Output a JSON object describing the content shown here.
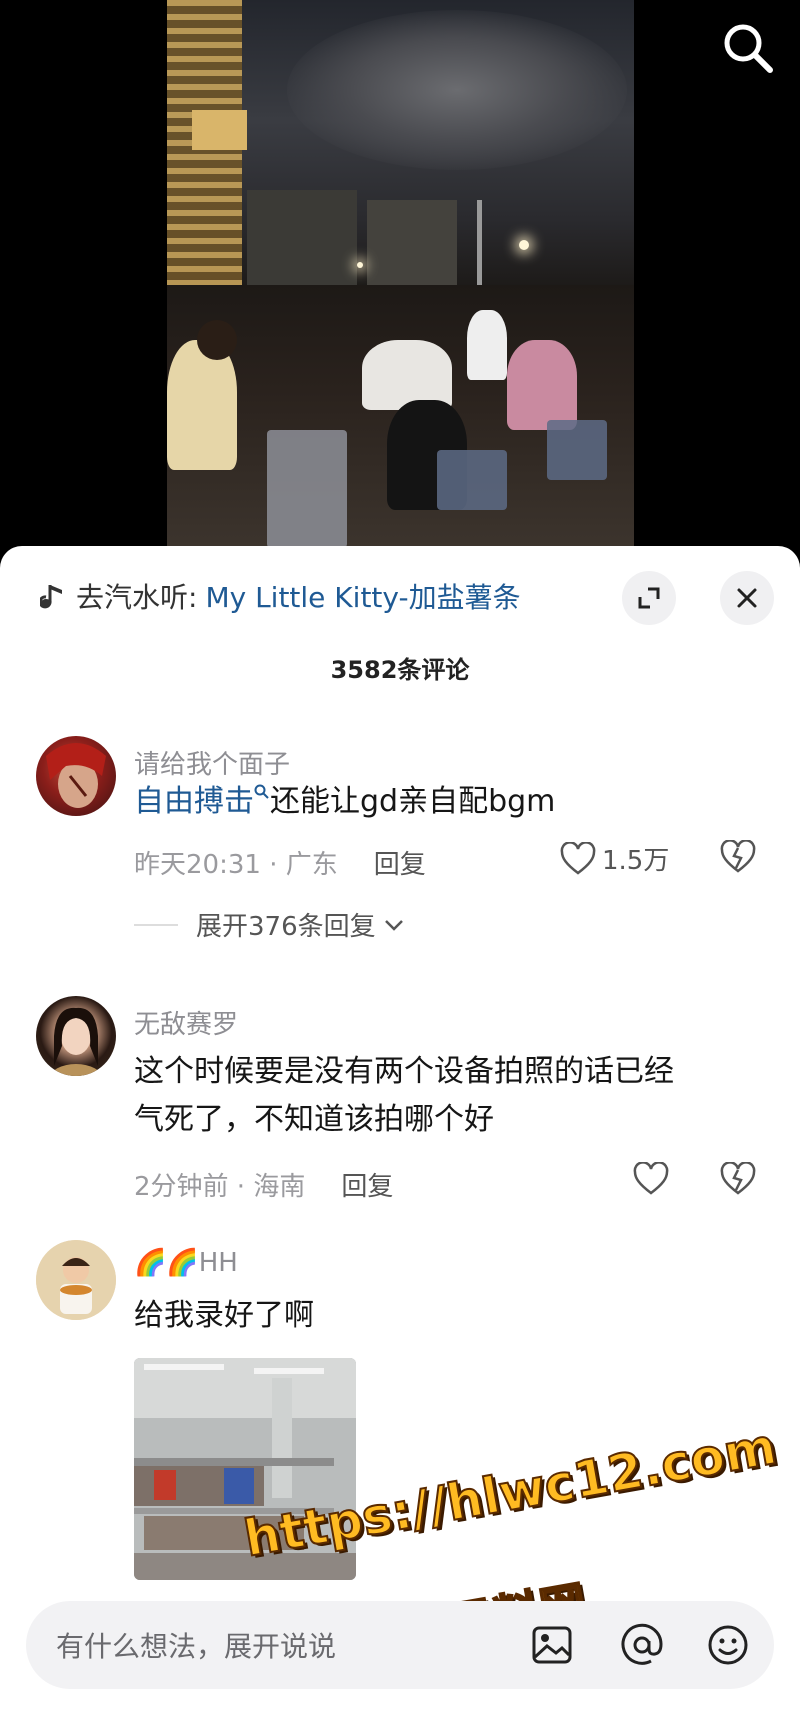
{
  "music": {
    "prefix": "去汽水听:",
    "title": "My Little Kitty-加盐薯条"
  },
  "comments_header": {
    "count_label": "3582条评论"
  },
  "comments": [
    {
      "user": "请给我个面子",
      "topic": "自由搏击",
      "text": "还能让gd亲自配bgm",
      "time_location": "昨天20:31 · 广东",
      "reply_label": "回复",
      "like_count": "1.5万",
      "expand_label": "展开376条回复"
    },
    {
      "user": "无敌赛罗",
      "text_line1": "这个时候要是没有两个设备拍照的话已经",
      "text_line2": "气死了，不知道该拍哪个好",
      "time_location": "2分钟前 · 海南",
      "reply_label": "回复"
    },
    {
      "user": "🌈🌈HH",
      "text": "给我录好了啊"
    }
  ],
  "input": {
    "placeholder": "有什么想法，展开说说"
  },
  "watermark": {
    "line1": "https://hlwc12.com",
    "line2": "黑料网"
  },
  "icons": {
    "search": "search-icon",
    "expand": "expand-icon",
    "close": "close-icon",
    "heart": "heart-icon",
    "broken_heart": "broken-heart-icon",
    "image": "image-icon",
    "at": "at-icon",
    "emoji": "emoji-icon"
  }
}
